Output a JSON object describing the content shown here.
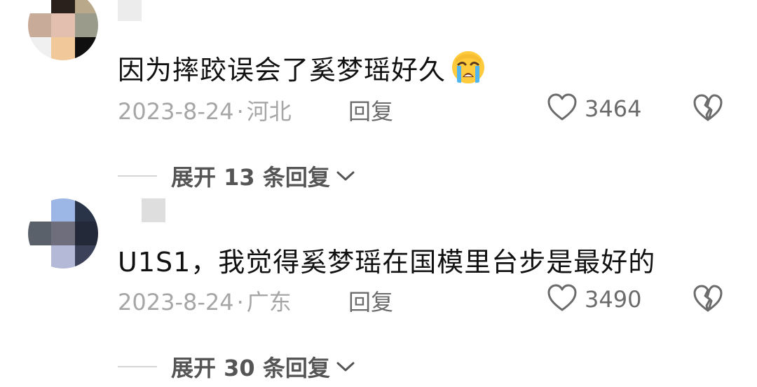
{
  "comments": [
    {
      "avatar_colors": [
        "#ffffff",
        "#2a211c",
        "#b9a98a",
        "#c9ab99",
        "#e2bfae",
        "#9b9b8c",
        "#f0f0f0",
        "#f0c89a",
        "#0f0f0f"
      ],
      "username_pixel_colors": [
        "#ececec"
      ],
      "text": "因为摔跤误会了奚梦瑶好久",
      "emoji": "loudly-crying-face",
      "date": "2023-8-24",
      "location": "河北",
      "reply_label": "回复",
      "likes": "3464",
      "expand_label": "展开 13 条回复"
    },
    {
      "avatar_colors": [
        "#ffffff",
        "#9cb7e6",
        "#2a3448",
        "#5b616b",
        "#6f6e7c",
        "#24293a",
        "#ffffff",
        "#b5b9d8",
        "#3a4159"
      ],
      "username_pixel_colors": [
        "#dedede"
      ],
      "text": "U1S1，我觉得奚梦瑶在国模里台步是最好的",
      "emoji": "",
      "date": "2023-8-24",
      "location": "广东",
      "reply_label": "回复",
      "likes": "3490",
      "expand_label": "展开 30 条回复"
    }
  ],
  "colors": {
    "text_primary": "#111111",
    "text_meta": "#a6a6a6",
    "text_secondary": "#6b6b6b",
    "divider": "#d6d6d6"
  }
}
